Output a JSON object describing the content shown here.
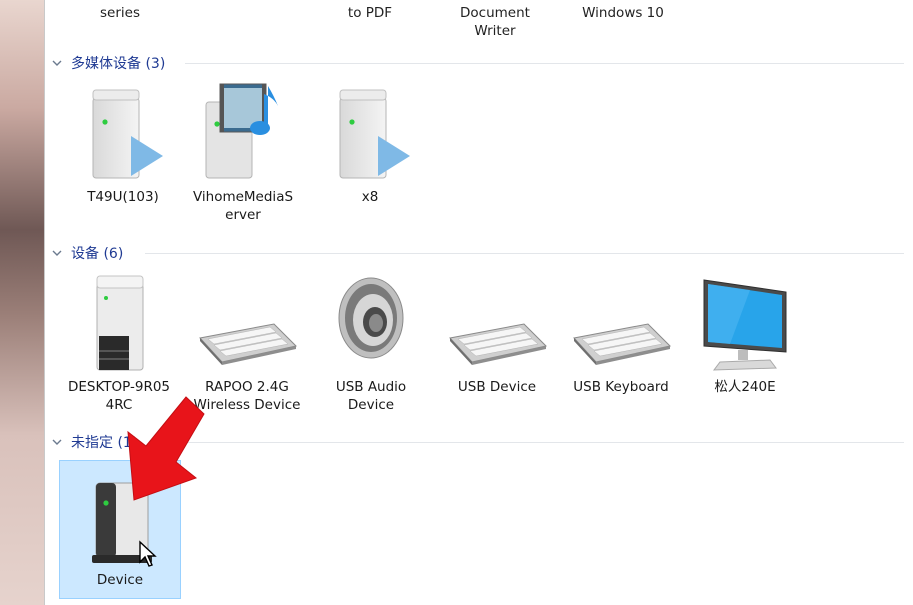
{
  "top_row": [
    {
      "label": "series"
    },
    {
      "label": "to PDF"
    },
    {
      "label": "Document\nWriter"
    },
    {
      "label": "Windows 10"
    }
  ],
  "groups": {
    "media": {
      "title": "多媒体设备 (3)",
      "items": [
        {
          "label": "T49U(103)",
          "icon": "media-server-play-icon"
        },
        {
          "label": "VihomeMediaS\nerver",
          "icon": "media-server-film-icon"
        },
        {
          "label": "x8",
          "icon": "media-server-play-icon"
        }
      ]
    },
    "devices": {
      "title": "设备 (6)",
      "items": [
        {
          "label": "DESKTOP-9R05\n4RC",
          "icon": "computer-tower-icon"
        },
        {
          "label": "RAPOO 2.4G\nWireless Device",
          "icon": "keyboard-icon"
        },
        {
          "label": "USB Audio\nDevice",
          "icon": "speaker-icon"
        },
        {
          "label": "USB Device",
          "icon": "keyboard-icon"
        },
        {
          "label": "USB Keyboard",
          "icon": "keyboard-icon"
        },
        {
          "label": "松人240E",
          "icon": "monitor-icon"
        }
      ]
    },
    "unspecified": {
      "title": "未指定 (1)",
      "items": [
        {
          "label": "Device",
          "icon": "generic-device-icon",
          "selected": true
        }
      ]
    }
  },
  "colors": {
    "group_header": "#1f3a93",
    "selection_bg": "#cce8ff",
    "arrow": "#e8141a"
  }
}
